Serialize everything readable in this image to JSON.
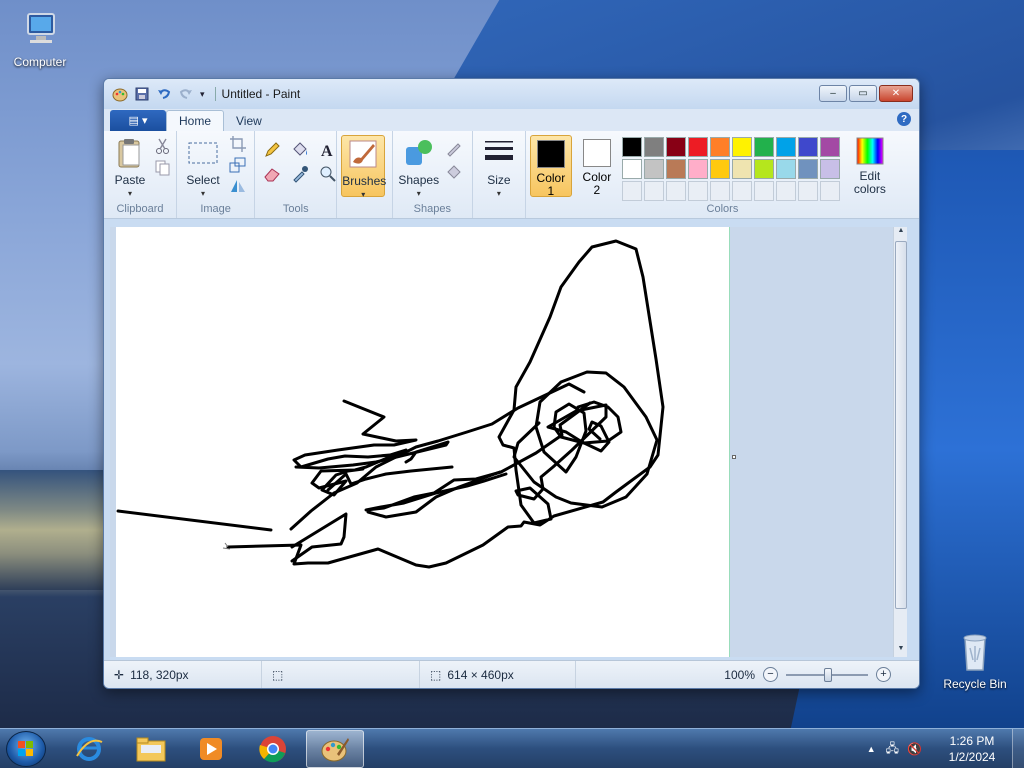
{
  "desktop": {
    "icons": [
      {
        "label": "Computer"
      },
      {
        "label": "Recycle Bin"
      }
    ]
  },
  "window": {
    "title": "Untitled - Paint",
    "controls": {
      "minimize": "–",
      "maximize": "▭",
      "close": "✕"
    }
  },
  "ribbon": {
    "file_tab": "▤ ▾",
    "tabs": [
      "Home",
      "View"
    ],
    "active_tab": "Home",
    "groups": {
      "clipboard": {
        "label": "Clipboard",
        "paste": "Paste"
      },
      "image": {
        "label": "Image",
        "select": "Select"
      },
      "tools": {
        "label": "Tools"
      },
      "brushes": {
        "label": "Brushes"
      },
      "shapes": {
        "label": "Shapes",
        "button": "Shapes"
      },
      "size": {
        "label": "Size"
      },
      "colors": {
        "label": "Colors",
        "color1": "Color",
        "color1_num": "1",
        "color2": "Color",
        "color2_num": "2",
        "edit_colors_1": "Edit",
        "edit_colors_2": "colors",
        "color1_value": "#000000",
        "color2_value": "#ffffff",
        "palette_row1": [
          "#000000",
          "#7f7f7f",
          "#880015",
          "#ed1c24",
          "#ff7f27",
          "#fff200",
          "#22b14c",
          "#00a2e8",
          "#3f48cc",
          "#a349a4"
        ],
        "palette_row2": [
          "#ffffff",
          "#c3c3c3",
          "#b97a57",
          "#ffaec9",
          "#ffc90e",
          "#efe4b0",
          "#b5e61d",
          "#99d9ea",
          "#7092be",
          "#c8bfe7"
        ]
      }
    }
  },
  "statusbar": {
    "cursor_pos": "118, 320px",
    "canvas_size": "614 × 460px",
    "zoom": "100%"
  },
  "taskbar": {
    "time": "1:26 PM",
    "date": "1/2/2024"
  }
}
